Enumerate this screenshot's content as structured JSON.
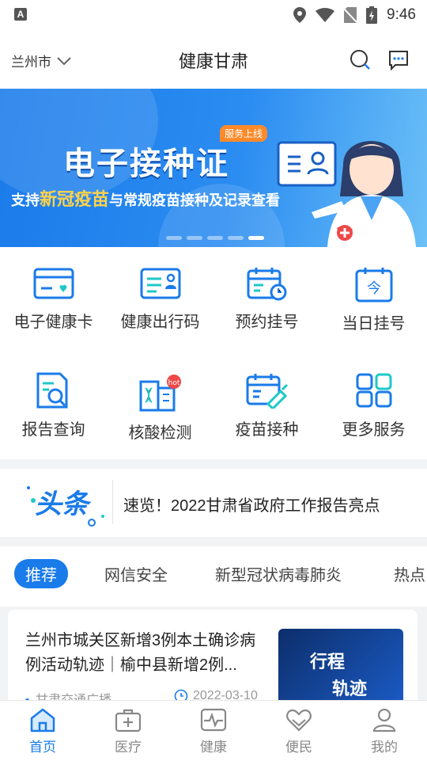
{
  "status_bar": {
    "time": "9:46"
  },
  "header": {
    "city": "兰州市",
    "title": "健康甘肃"
  },
  "banner": {
    "badge": "服务上线",
    "title": "电子接种证",
    "subtitle_prefix": "支持",
    "subtitle_highlight": "新冠疫苗",
    "subtitle_suffix": "与常规疫苗接种及记录查看",
    "slide_count": 5,
    "active_slide": 5
  },
  "services": [
    {
      "label": "电子健康卡",
      "icon": "health-card-icon"
    },
    {
      "label": "健康出行码",
      "icon": "travel-code-icon"
    },
    {
      "label": "预约挂号",
      "icon": "appointment-icon"
    },
    {
      "label": "当日挂号",
      "icon": "same-day-register-icon"
    },
    {
      "label": "报告查询",
      "icon": "report-search-icon"
    },
    {
      "label": "核酸检测",
      "icon": "nucleic-test-icon",
      "badge": "hot"
    },
    {
      "label": "疫苗接种",
      "icon": "vaccine-icon"
    },
    {
      "label": "更多服务",
      "icon": "more-services-icon"
    }
  ],
  "headline": {
    "logo_text": "头条",
    "text": "速览！2022甘肃省政府工作报告亮点"
  },
  "tabs": [
    "推荐",
    "网信安全",
    "新型冠状病毒肺炎",
    "热点"
  ],
  "active_tab": "推荐",
  "feed": [
    {
      "title": "兰州市城关区新增3例本土确诊病例活动轨迹｜榆中县新增2例...",
      "source": "甘肃交通广播",
      "date": "2022-03-10",
      "thumb_line1": "行程",
      "thumb_line2": "轨迹"
    }
  ],
  "bottom_nav": [
    {
      "label": "首页",
      "icon": "home-icon",
      "active": true
    },
    {
      "label": "医疗",
      "icon": "medical-kit-icon"
    },
    {
      "label": "健康",
      "icon": "heartbeat-icon"
    },
    {
      "label": "便民",
      "icon": "heart-hands-icon"
    },
    {
      "label": "我的",
      "icon": "user-icon"
    }
  ],
  "colors": {
    "primary": "#1a7bea",
    "accent": "#ff8a2a",
    "highlight": "#ffd24a"
  }
}
